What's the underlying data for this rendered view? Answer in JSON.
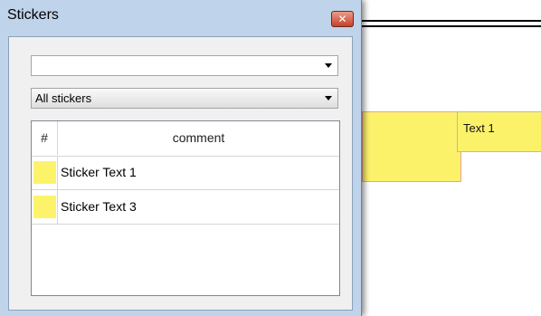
{
  "window": {
    "title": "Stickers",
    "close_icon": "close-icon",
    "close_glyph": "✕"
  },
  "filter_combo": {
    "value": ""
  },
  "category_combo": {
    "value": "All stickers"
  },
  "table": {
    "columns": [
      "#",
      "comment"
    ],
    "rows": [
      {
        "color": "#fdf36a",
        "comment": "Sticker Text 1"
      },
      {
        "color": "#fdf36a",
        "comment": "Sticker Text 3"
      }
    ]
  },
  "document": {
    "sticker_text": "Text 1",
    "sticker_color": "#fcf26a"
  }
}
